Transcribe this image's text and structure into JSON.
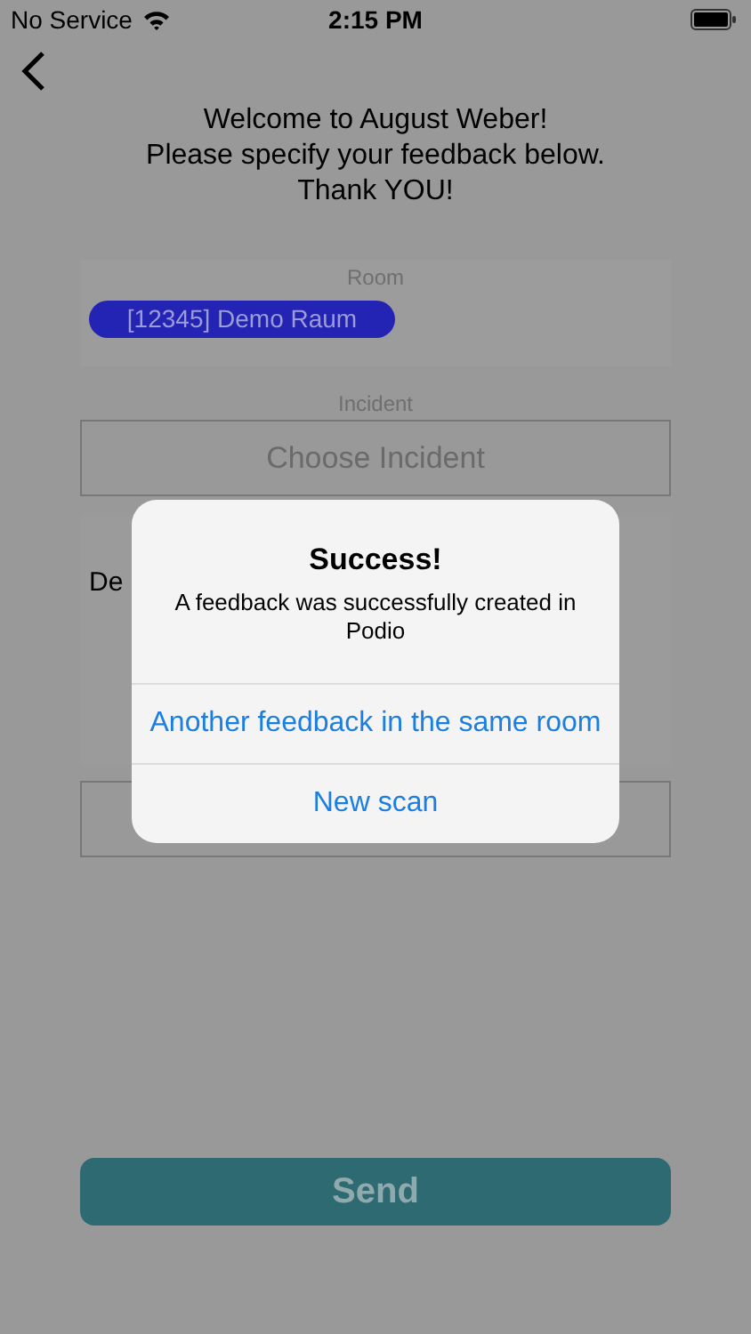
{
  "status_bar": {
    "carrier": "No Service",
    "time": "2:15 PM"
  },
  "welcome": [
    "Welcome to August Weber!",
    "Please specify your feedback below.",
    "Thank YOU!"
  ],
  "room": {
    "label": "Room",
    "value": "[12345] Demo Raum"
  },
  "incident": {
    "label": "Incident",
    "placeholder": "Choose Incident"
  },
  "description_label": "De",
  "send_button": "Send",
  "alert": {
    "title": "Success!",
    "message": "A feedback was successfully created in Podio",
    "actions": [
      "Another feedback in the same room",
      "New scan"
    ]
  }
}
